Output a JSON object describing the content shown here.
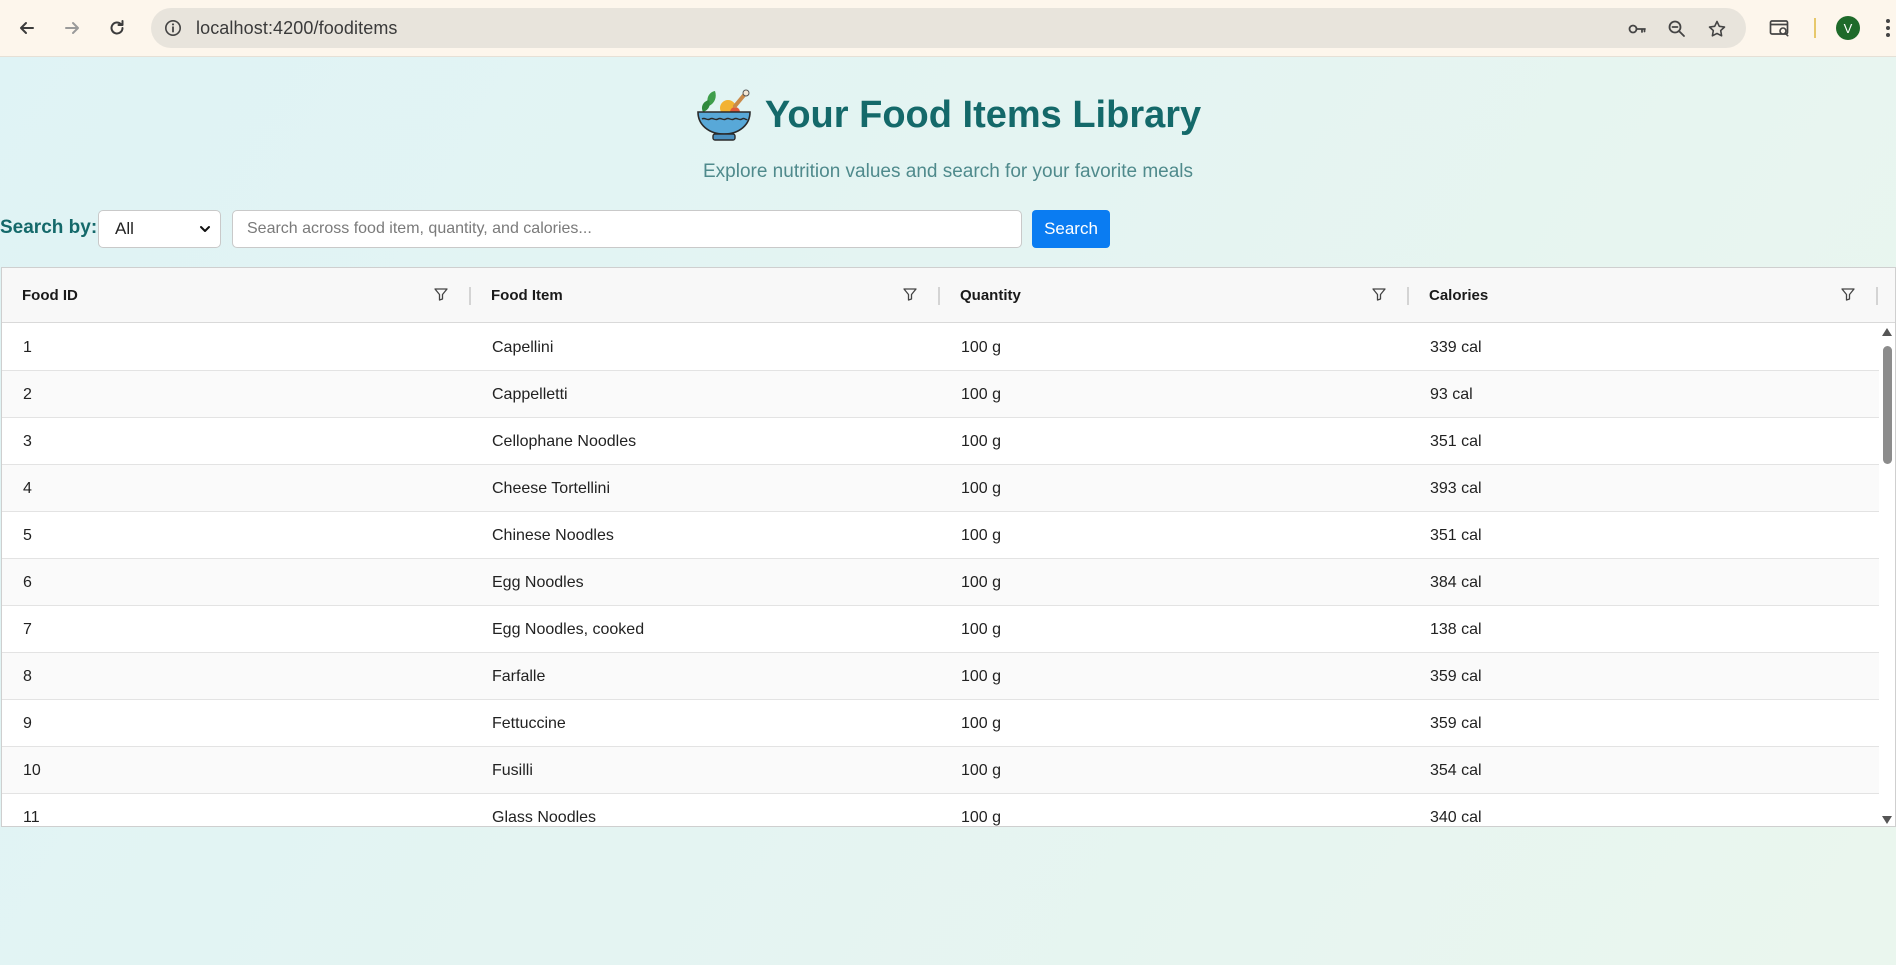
{
  "browser": {
    "url": "localhost:4200/fooditems",
    "avatar_letter": "V"
  },
  "header": {
    "title": "Your Food Items Library",
    "subtitle": "Explore nutrition values and search for your favorite meals",
    "logo_icon": "salad-bowl-icon"
  },
  "search": {
    "label": "Search by:",
    "filter_value": "All",
    "placeholder": "Search across food item, quantity, and calories...",
    "button_label": "Search"
  },
  "grid": {
    "columns": [
      "Food ID",
      "Food Item",
      "Quantity",
      "Calories"
    ],
    "rows": [
      {
        "id": "1",
        "item": "Capellini",
        "quantity": "100 g",
        "calories": "339 cal"
      },
      {
        "id": "2",
        "item": "Cappelletti",
        "quantity": "100 g",
        "calories": "93 cal"
      },
      {
        "id": "3",
        "item": "Cellophane Noodles",
        "quantity": "100 g",
        "calories": "351 cal"
      },
      {
        "id": "4",
        "item": "Cheese Tortellini",
        "quantity": "100 g",
        "calories": "393 cal"
      },
      {
        "id": "5",
        "item": "Chinese Noodles",
        "quantity": "100 g",
        "calories": "351 cal"
      },
      {
        "id": "6",
        "item": "Egg Noodles",
        "quantity": "100 g",
        "calories": "384 cal"
      },
      {
        "id": "7",
        "item": "Egg Noodles, cooked",
        "quantity": "100 g",
        "calories": "138 cal"
      },
      {
        "id": "8",
        "item": "Farfalle",
        "quantity": "100 g",
        "calories": "359 cal"
      },
      {
        "id": "9",
        "item": "Fettuccine",
        "quantity": "100 g",
        "calories": "359 cal"
      },
      {
        "id": "10",
        "item": "Fusilli",
        "quantity": "100 g",
        "calories": "354 cal"
      },
      {
        "id": "11",
        "item": "Glass Noodles",
        "quantity": "100 g",
        "calories": "340 cal"
      }
    ]
  },
  "colors": {
    "title": "#14696a",
    "subtitle": "#4f8a8c",
    "search_button": "#0a7cf2",
    "avatar": "#1e6a2a"
  }
}
